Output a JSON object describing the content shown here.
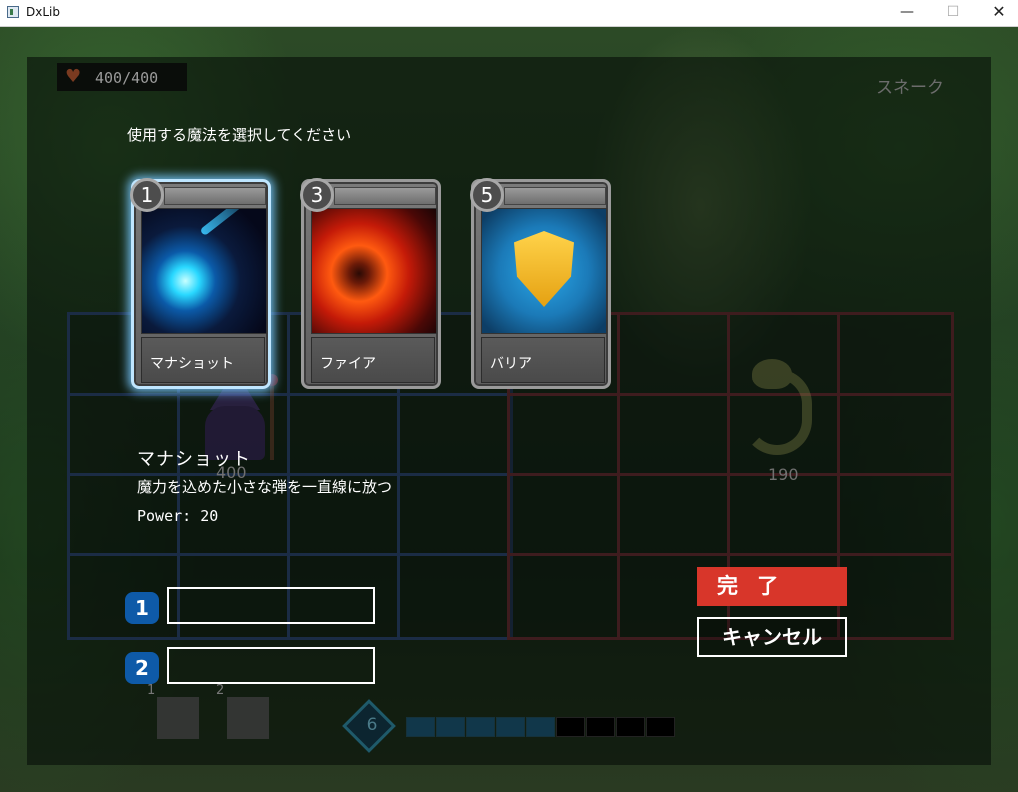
{
  "window": {
    "title": "DxLib",
    "minimize_glyph": "—",
    "maximize_glyph": "☐",
    "close_glyph": "✕"
  },
  "player": {
    "hp_text": "400/400",
    "hp_value": "400",
    "heart_icon": "heart-icon"
  },
  "enemy": {
    "name": "スネーク",
    "hp_value": "190"
  },
  "prompt": "使用する魔法を選択してください",
  "cards": [
    {
      "cost": "1",
      "name": "マナショット",
      "selected": true
    },
    {
      "cost": "3",
      "name": "ファイア",
      "selected": false
    },
    {
      "cost": "5",
      "name": "バリア",
      "selected": false
    }
  ],
  "description": {
    "name": "マナショット",
    "text": "魔力を込めた小さな弾を一直線に放つ",
    "power": "Power: 20"
  },
  "slots": [
    {
      "number": "1"
    },
    {
      "number": "2"
    }
  ],
  "buttons": {
    "done": "完 了",
    "cancel": "キャンセル"
  },
  "hand": {
    "labels": [
      "1",
      "2"
    ]
  },
  "mana": {
    "current": "6",
    "segments_filled": 5,
    "segments_total": 9
  },
  "colors": {
    "done_button": "#d8362a",
    "slot_badge": "#0e5aa8",
    "selection_glow": "#bfe6ff"
  }
}
